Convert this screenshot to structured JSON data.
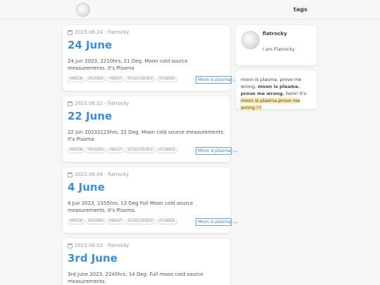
{
  "nav": {
    "tags_label": "tags"
  },
  "posts": [
    {
      "meta": "2023.06.24 - flatrocky",
      "title": "24 June",
      "excerpt": "24 Jun 2023, 2210hrs, 21 Deg. Moon cold source measurements. It's Plasma",
      "tags": [
        "#MOON",
        "#PLASMA",
        "#NIGHT",
        "#COLD SOURCE",
        "#CANADA"
      ],
      "link_text": "Moon is plasma.",
      "arrow": "→"
    },
    {
      "meta": "2023.06.22 - flatrocky",
      "title": "22 June",
      "excerpt": "22 Jun 20232123hrs, 22 Deg. Moon cold source measurements. It's Plasma",
      "tags": [
        "#MOON",
        "#PLASMA",
        "#NIGHT",
        "#COLD SOURCE",
        "#CANADA"
      ],
      "link_text": "Moon is plasma.",
      "arrow": "→"
    },
    {
      "meta": "2023.06.04 - flatrocky",
      "title": "4 June",
      "excerpt": "4 Jun 2023, 2355hrs, 13 Deg Full Moon cold source measurements. It's Plasma.",
      "tags": [
        "#MOON",
        "#PLASMA",
        "#NIGHT",
        "#COLD SOURCE",
        "#CANADA"
      ],
      "link_text": "Moon is plasma.",
      "arrow": "→"
    },
    {
      "meta": "2023.06.03 - flatrocky",
      "title": "3rd June",
      "excerpt": "3rd June 2023, 2245hrs, 14 Deg. Full moon cold source measurements."
    }
  ],
  "profile": {
    "name": "flatrocky",
    "bio": "I am Flatrocky"
  },
  "note": {
    "part1": "moon is plasma. prove me wrong.",
    "part2": "moon is plasma. prove me wrong.",
    "part3": "here! It's",
    "part4": "moon is plasma.prove me wrong.!!!"
  }
}
